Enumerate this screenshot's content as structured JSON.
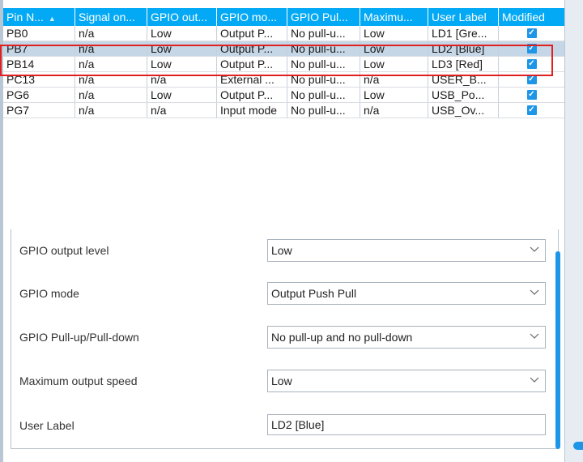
{
  "table": {
    "columns": [
      "Pin N...",
      "Signal on...",
      "GPIO out...",
      "GPIO mo...",
      "GPIO Pul...",
      "Maximu...",
      "User Label",
      "Modified"
    ],
    "rows": [
      [
        "PB0",
        "n/a",
        "Low",
        "Output P...",
        "No pull-u...",
        "Low",
        "LD1 [Gre...",
        "checked"
      ],
      [
        "PB7",
        "n/a",
        "Low",
        "Output P...",
        "No pull-u...",
        "Low",
        "LD2 [Blue]",
        "checked"
      ],
      [
        "PB14",
        "n/a",
        "Low",
        "Output P...",
        "No pull-u...",
        "Low",
        "LD3 [Red]",
        "checked"
      ],
      [
        "PC13",
        "n/a",
        "n/a",
        "External ...",
        "No pull-u...",
        "n/a",
        "USER_B...",
        "checked"
      ],
      [
        "PG6",
        "n/a",
        "Low",
        "Output P...",
        "No pull-u...",
        "Low",
        "USB_Po...",
        "checked"
      ],
      [
        "PG7",
        "n/a",
        "n/a",
        "Input mode",
        "No pull-u...",
        "n/a",
        "USB_Ov...",
        "checked"
      ]
    ],
    "selected_row": "PB7",
    "sort_icon": "sort-up-icon",
    "checkbox_icon": "checkmark-icon"
  },
  "properties": {
    "output_level": {
      "label": "GPIO output level",
      "value": "Low"
    },
    "mode": {
      "label": "GPIO mode",
      "value": "Output Push Pull"
    },
    "pull": {
      "label": "GPIO Pull-up/Pull-down",
      "value": "No pull-up and no pull-down"
    },
    "speed": {
      "label": "Maximum output speed",
      "value": "Low"
    },
    "user_label": {
      "label": "User Label",
      "value": "LD2 [Blue]"
    }
  },
  "colors": {
    "header_bg": "#03a9f4",
    "selected_row_bg": "#c5d6e6",
    "highlight_border": "#e02020",
    "checkbox": "#1e96e8"
  }
}
